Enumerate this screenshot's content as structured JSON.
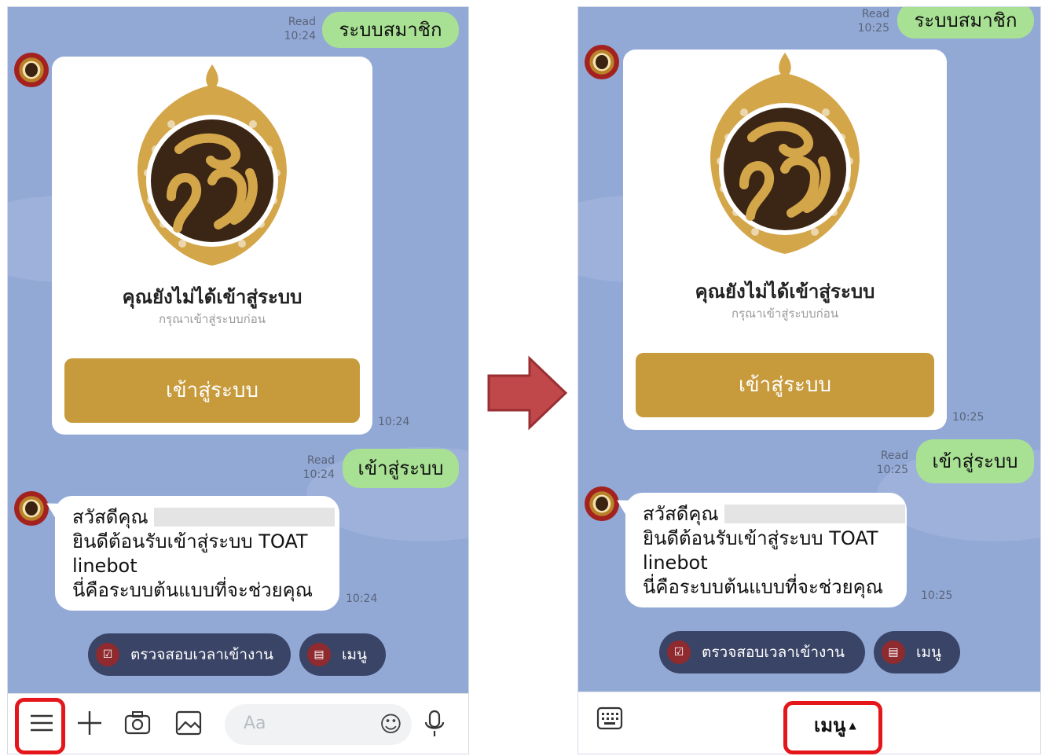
{
  "screens": {
    "before": {
      "sent_first": {
        "read": "Read",
        "time": "10:24",
        "text": "ระบบสมาชิก"
      },
      "card": {
        "title": "คุณยังไม่ได้เข้าสู่ระบบ",
        "subtitle": "กรุณาเข้าสู่ระบบก่อน",
        "button": "เข้าสู่ระบบ",
        "time": "10:24"
      },
      "sent_second": {
        "read": "Read",
        "time": "10:24",
        "text": "เข้าสู่ระบบ"
      },
      "welcome": {
        "line1": "สวัสดีคุณ",
        "line2": "ยินดีต้อนรับเข้าสู่ระบบ TOAT",
        "line3": "linebot",
        "line4": "นี่คือระบบต้นแบบที่จะช่วยคุณ",
        "time": "10:24"
      },
      "quick_replies": [
        {
          "icon": "checkbox-icon",
          "label": "ตรวจสอบเวลาเข้างาน"
        },
        {
          "icon": "clipboard-icon",
          "label": "เมนู"
        }
      ],
      "toolbar": {
        "input_placeholder": "Aa"
      }
    },
    "after": {
      "sent_first": {
        "read": "Read",
        "time": "10:25",
        "text": "ระบบสมาชิก"
      },
      "card": {
        "title": "คุณยังไม่ได้เข้าสู่ระบบ",
        "subtitle": "กรุณาเข้าสู่ระบบก่อน",
        "button": "เข้าสู่ระบบ",
        "time": "10:25"
      },
      "sent_second": {
        "read": "Read",
        "time": "10:25",
        "text": "เข้าสู่ระบบ"
      },
      "welcome": {
        "line1": "สวัสดีคุณ",
        "line2": "ยินดีต้อนรับเข้าสู่ระบบ TOAT",
        "line3": "linebot",
        "line4": "นี่คือระบบต้นแบบที่จะช่วยคุณ",
        "time": "10:25"
      },
      "quick_replies": [
        {
          "icon": "checkbox-icon",
          "label": "ตรวจสอบเวลาเข้างาน"
        },
        {
          "icon": "clipboard-icon",
          "label": "เมนู"
        }
      ],
      "toolbar": {
        "menu_label": "เมนู"
      }
    }
  },
  "colors": {
    "chat_background": "#92a9d6",
    "outgoing_bubble": "#a8e193",
    "login_button": "#c79a3c",
    "quick_reply": "#3a4466",
    "highlight_box": "#e5161a",
    "arrow": "#c0474a"
  }
}
